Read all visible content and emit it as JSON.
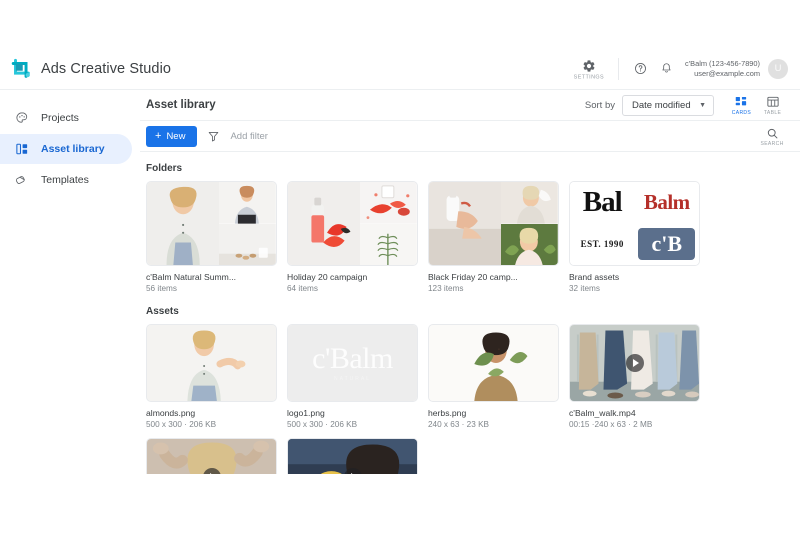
{
  "app": {
    "name": "Ads Creative Studio",
    "logo_icon": "crop-tool-logo-icon"
  },
  "header": {
    "settings_label": "SETTINGS",
    "settings_icon": "gear-icon",
    "help_icon": "help-circle-icon",
    "notifications_icon": "bell-icon",
    "account_name": "c'Balm (123-456-7890)",
    "account_email": "user@example.com",
    "avatar_initial": "U"
  },
  "sidebar": {
    "items": [
      {
        "label": "Projects",
        "icon": "palette-icon",
        "active": false
      },
      {
        "label": "Asset library",
        "icon": "library-grid-icon",
        "active": true
      },
      {
        "label": "Templates",
        "icon": "layers-icon",
        "active": false
      }
    ]
  },
  "main": {
    "title": "Asset library",
    "sort_label": "Sort by",
    "sort_value": "Date modified",
    "view_cards_label": "CARDS",
    "view_table_label": "TABLE",
    "view_active": "CARDS",
    "new_button_label": "New",
    "filter_icon": "funnel-icon",
    "add_filter_placeholder": "Add filter",
    "search_label": "SEARCH",
    "search_icon": "magnifier-icon"
  },
  "sections": {
    "folders_title": "Folders",
    "assets_title": "Assets"
  },
  "folders": [
    {
      "name": "c'Balm Natural Summ...",
      "count": "56 items"
    },
    {
      "name": "Holiday 20 campaign",
      "count": "64 items"
    },
    {
      "name": "Black Friday 20 camp...",
      "count": "123 items"
    },
    {
      "name": "Brand assets",
      "count": "32 items"
    }
  ],
  "brand_tiles": {
    "wordmark_dark": "Bal",
    "wordmark_red": "Balm",
    "est_text": "EST. 1990",
    "monogram": "c'B"
  },
  "logo_thumb": {
    "wordmark": "c'Balm",
    "tagline": "NATURAL"
  },
  "assets": [
    {
      "name": "almonds.png",
      "meta": "500 x 300 · 206 KB",
      "type": "image"
    },
    {
      "name": "logo1.png",
      "meta": "500 x 300 · 206 KB",
      "type": "logo"
    },
    {
      "name": "herbs.png",
      "meta": "240 x 63 · 23 KB",
      "type": "image"
    },
    {
      "name": "c'Balm_walk.mp4",
      "meta": "00:15 ·240 x 63 · 2 MB",
      "type": "video"
    }
  ],
  "colors": {
    "accent": "#1a73e8",
    "active_nav_bg": "#e8f0fe",
    "active_nav_text": "#1967d2",
    "text_primary": "#3c4043",
    "text_secondary": "#80868b"
  }
}
